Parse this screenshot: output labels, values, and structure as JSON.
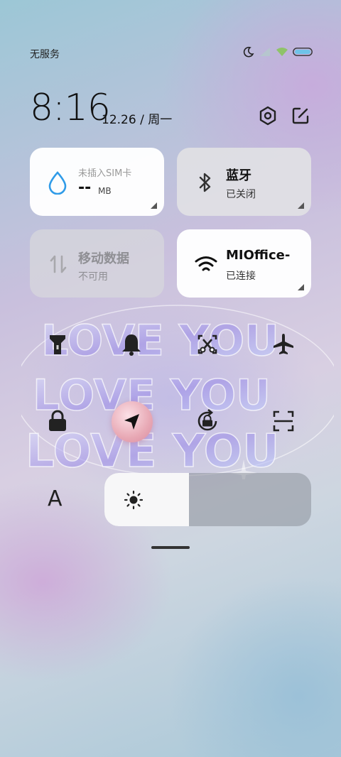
{
  "status_bar": {
    "carrier": "无服务",
    "icons": [
      "moon-icon",
      "signal-icon",
      "wifi-icon",
      "battery-icon"
    ]
  },
  "header": {
    "time": "8:16",
    "date": "12.26 / 周一",
    "icons": [
      "settings-icon",
      "edit-icon"
    ]
  },
  "tiles": {
    "data_usage": {
      "title": "未插入SIM卡",
      "value": "--",
      "unit": "MB",
      "icon": "water-drop-icon"
    },
    "bluetooth": {
      "title": "蓝牙",
      "status": "已关闭",
      "icon": "bluetooth-icon"
    },
    "mobile_data": {
      "title": "移动数据",
      "status": "不可用",
      "icon": "data-arrows-icon"
    },
    "wifi": {
      "title": "MIOffice-",
      "status": "已连接",
      "icon": "wifi-icon"
    }
  },
  "wallpaper_text": [
    "LOVE YOU",
    "LOVE YOU",
    "LOVE YOU"
  ],
  "toggles": [
    "flashlight-icon",
    "bell-icon",
    "screenshot-icon",
    "airplane-icon",
    "lock-icon",
    "location-icon",
    "rotation-lock-icon",
    "scan-icon"
  ],
  "brightness": {
    "level": 0.41,
    "icon": "sun-icon",
    "auto_icon": "font-a-icon",
    "auto_label": "A"
  },
  "colors": {
    "accent": "#2f9be8",
    "active_location": "#e8a9b5"
  }
}
